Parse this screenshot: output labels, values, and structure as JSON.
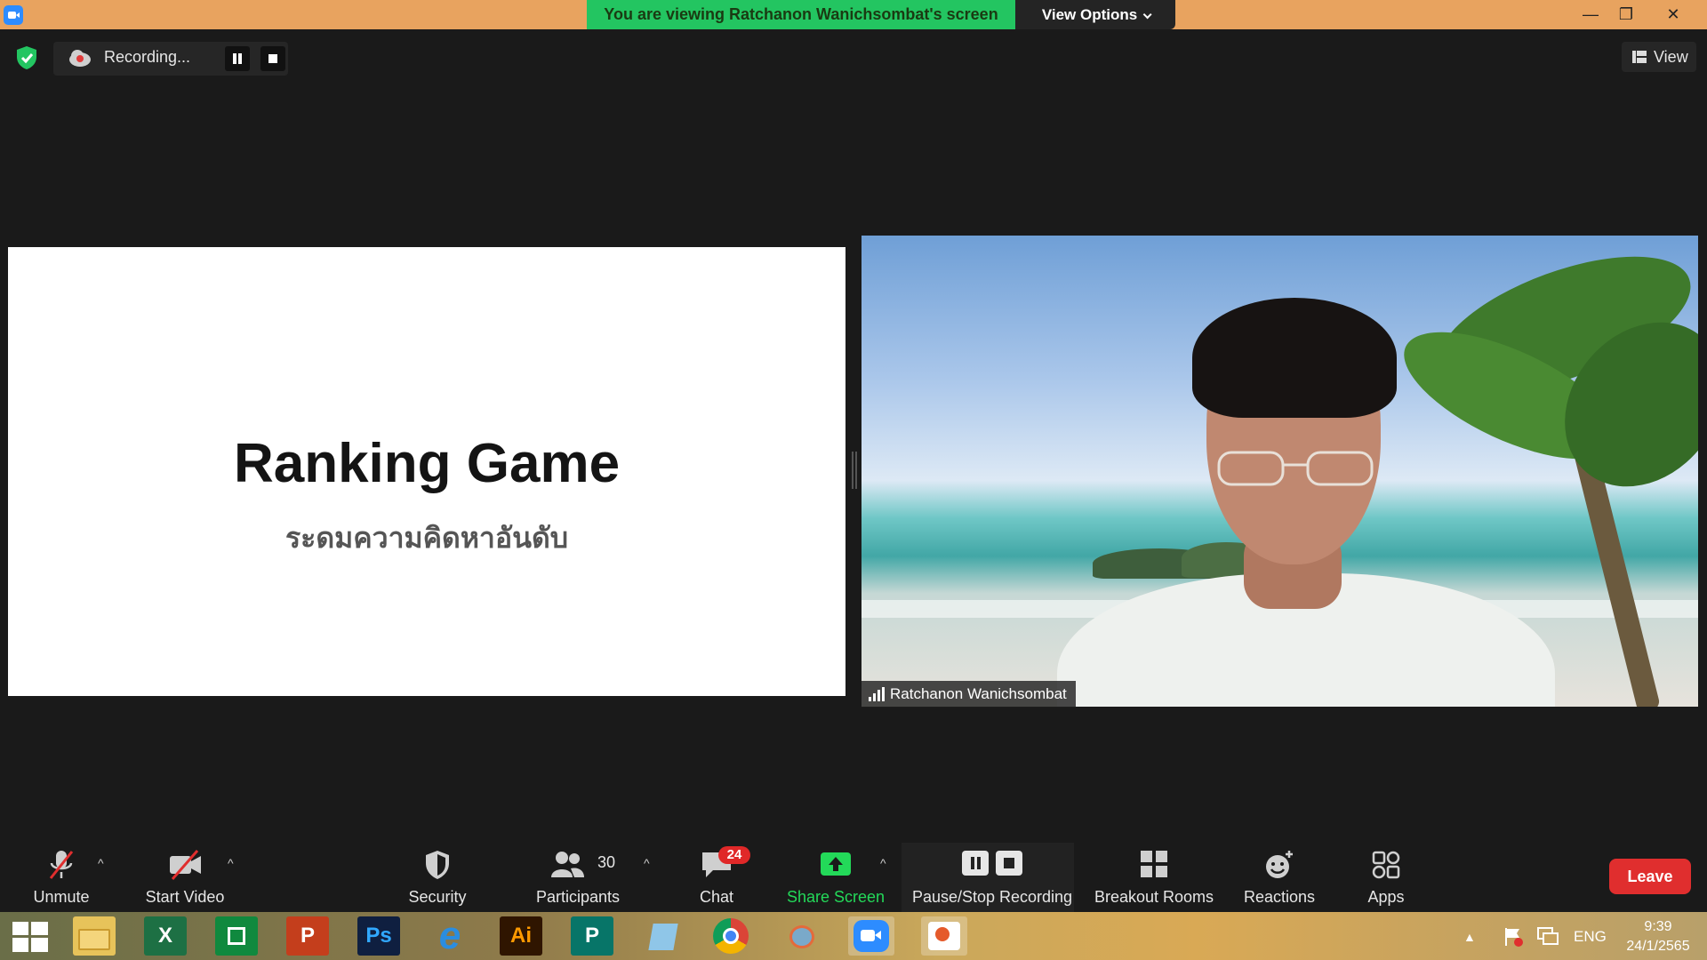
{
  "titlebar": {
    "viewing_banner": "You are viewing Ratchanon Wanichsombat's screen",
    "view_options_label": "View Options"
  },
  "recording_bar": {
    "status_label": "Recording...",
    "view_label": "View"
  },
  "slide": {
    "title": "Ranking Game",
    "subtitle": "ระดมความคิดหาอันดับ"
  },
  "video": {
    "participant_name": "Ratchanon Wanichsombat"
  },
  "toolbar": {
    "unmute_label": "Unmute",
    "start_video_label": "Start Video",
    "security_label": "Security",
    "participants_label": "Participants",
    "participants_count": "30",
    "chat_label": "Chat",
    "chat_badge": "24",
    "share_screen_label": "Share Screen",
    "recording_label": "Pause/Stop Recording",
    "breakout_label": "Breakout Rooms",
    "reactions_label": "Reactions",
    "apps_label": "Apps",
    "leave_label": "Leave"
  },
  "taskbar": {
    "excel_label": "X",
    "powerpoint_label": "P",
    "photoshop_label": "Ps",
    "illustrator_label": "Ai",
    "publisher_label": "P",
    "language": "ENG",
    "time": "9:39",
    "date": "24/1/2565"
  },
  "colors": {
    "banner_green": "#23c561",
    "titlebar_orange": "#e8a35f",
    "share_green": "#23d959",
    "leave_red": "#e02e2e"
  }
}
